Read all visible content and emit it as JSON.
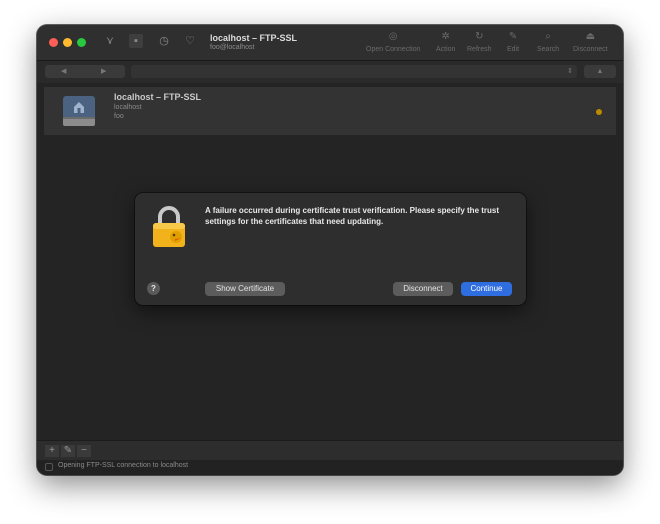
{
  "window": {
    "title": "localhost – FTP-SSL",
    "subtitle": "foo@localhost"
  },
  "toolbar": {
    "items": [
      {
        "label": "Open Connection",
        "icon": "globe-icon"
      },
      {
        "label": "Action",
        "icon": "gear-icon"
      },
      {
        "label": "Refresh",
        "icon": "refresh-icon"
      },
      {
        "label": "Edit",
        "icon": "pencil-icon"
      },
      {
        "label": "Search",
        "icon": "search-icon"
      },
      {
        "label": "Disconnect",
        "icon": "eject-icon"
      }
    ]
  },
  "bookmark": {
    "title": "localhost – FTP-SSL",
    "host": "localhost",
    "user": "foo",
    "status_color": "#c08a00"
  },
  "dialog": {
    "message": "A failure occurred during certificate trust verification. Please specify the trust settings for the certificates that need updating.",
    "help_label": "?",
    "show_certificate_label": "Show Certificate",
    "disconnect_label": "Disconnect",
    "continue_label": "Continue",
    "accent": "#2f6ee0"
  },
  "bottombar": {
    "add_label": "+",
    "edit_label": "✎",
    "remove_label": "−"
  },
  "status": {
    "message": "Opening FTP-SSL connection to localhost"
  }
}
